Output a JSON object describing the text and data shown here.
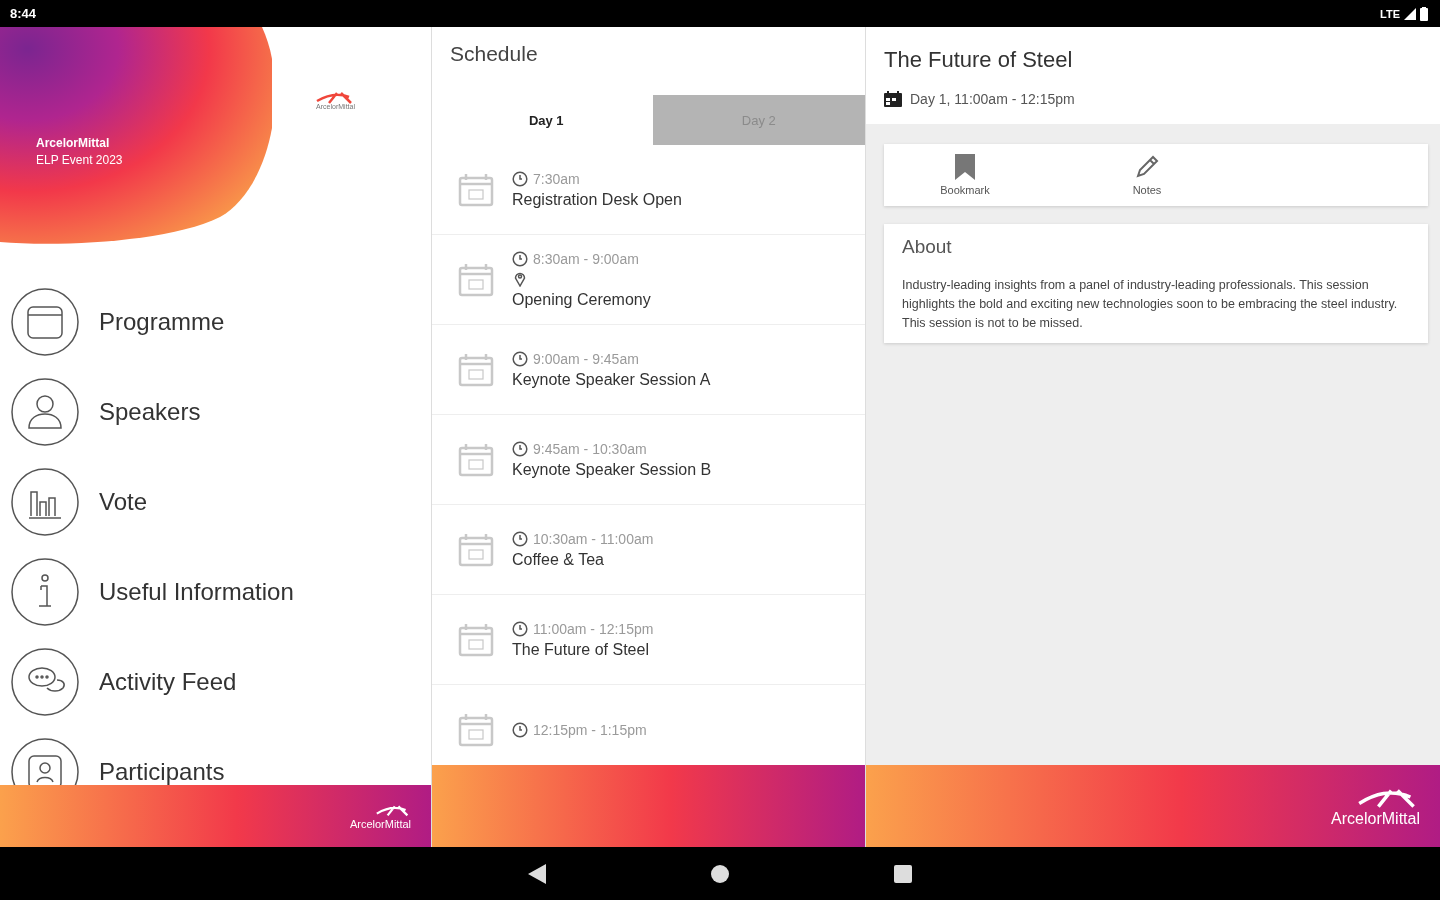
{
  "status_bar": {
    "time": "8:44",
    "network": "LTE"
  },
  "menu": {
    "header": {
      "title": "ArcelorMittal",
      "subtitle": "ELP Event 2023",
      "logo_text": "ArcelorMittal"
    },
    "items": [
      {
        "kind": "calendar",
        "label": "Programme"
      },
      {
        "kind": "person",
        "label": "Speakers"
      },
      {
        "kind": "chart",
        "label": "Vote"
      },
      {
        "kind": "info",
        "label": "Useful Information"
      },
      {
        "kind": "chat",
        "label": "Activity Feed"
      },
      {
        "kind": "badge",
        "label": "Participants"
      }
    ],
    "footer_logo": "ArcelorMittal"
  },
  "schedule": {
    "title": "Schedule",
    "tabs": [
      {
        "label": "Day 1",
        "selected": true
      },
      {
        "label": "Day 2",
        "selected": false
      }
    ],
    "items": [
      {
        "time": "7:30am",
        "location": false,
        "title": "Registration Desk Open"
      },
      {
        "time": "8:30am - 9:00am",
        "location": true,
        "title": "Opening Ceremony"
      },
      {
        "time": "9:00am - 9:45am",
        "location": false,
        "title": "Keynote Speaker Session A"
      },
      {
        "time": "9:45am - 10:30am",
        "location": false,
        "title": "Keynote Speaker Session B"
      },
      {
        "time": "10:30am - 11:00am",
        "location": false,
        "title": "Coffee & Tea"
      },
      {
        "time": "11:00am - 12:15pm",
        "location": false,
        "title": "The Future of Steel"
      },
      {
        "time": "12:15pm - 1:15pm",
        "location": false
      }
    ]
  },
  "detail": {
    "title": "The Future of Steel",
    "when": "Day 1, 11:00am - 12:15pm",
    "actions": [
      {
        "kind": "bookmark",
        "label": "Bookmark"
      },
      {
        "kind": "notes",
        "label": "Notes"
      }
    ],
    "about": {
      "heading": "About",
      "text": "Industry-leading insights from a panel of industry-leading professionals. This session highlights the bold and exciting new technologies soon to be embracing the steel industry. This session is not to be missed."
    },
    "footer_logo": "ArcelorMittal"
  }
}
